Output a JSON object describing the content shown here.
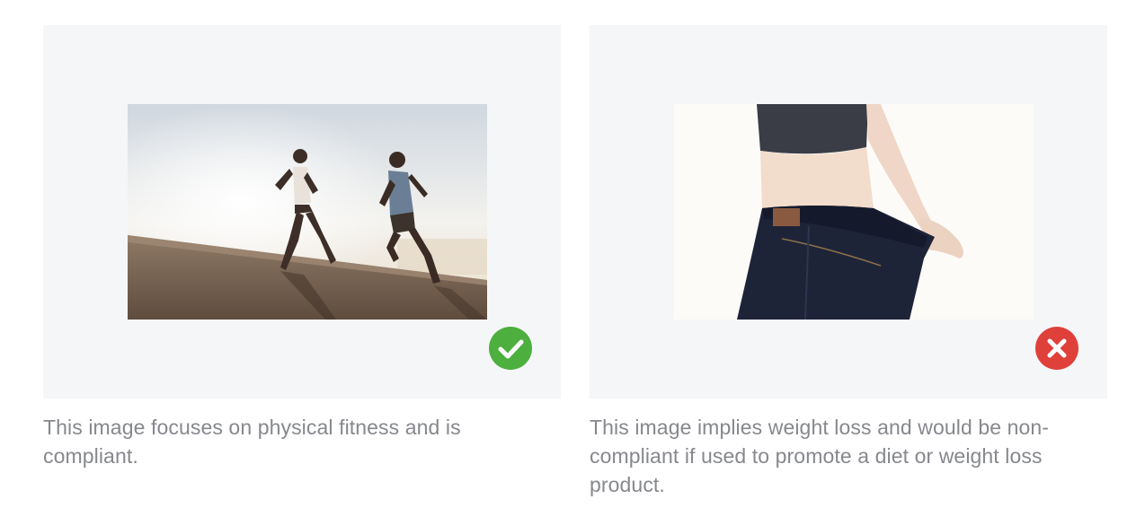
{
  "examples": [
    {
      "image_subject": "Two people running uphill on a road at sunrise",
      "status": "compliant",
      "status_icon": "check-circle-icon",
      "status_color": "#4caf3e",
      "caption": "This image focuses on physical fitness and is compliant."
    },
    {
      "image_subject": "Person holding out waistband of oversized jeans",
      "status": "non-compliant",
      "status_icon": "x-circle-icon",
      "status_color": "#e0403a",
      "caption": "This image implies weight loss and would be non-compliant if used to promote a diet or weight loss product."
    }
  ]
}
